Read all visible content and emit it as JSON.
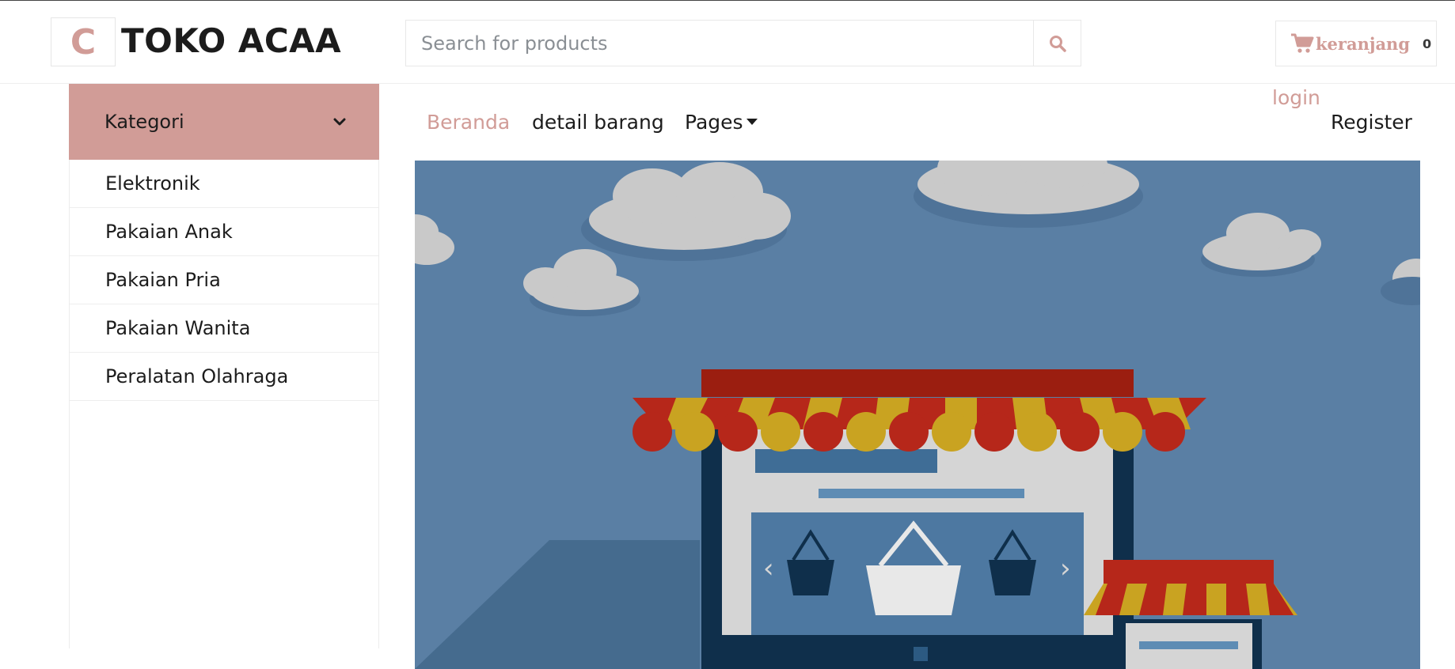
{
  "header": {
    "logo_letter": "C",
    "brand_name": "TOKO ACAA",
    "search_placeholder": "Search for products",
    "search_icon": "search-icon",
    "cart": {
      "icon": "cart-icon",
      "label": "keranjang",
      "count": "0"
    }
  },
  "sidebar": {
    "title": "Kategori",
    "toggle_icon": "chevron-down-icon",
    "items": [
      {
        "label": "Elektronik"
      },
      {
        "label": "Pakaian Anak"
      },
      {
        "label": "Pakaian Pria"
      },
      {
        "label": "Pakaian Wanita"
      },
      {
        "label": "Peralatan Olahraga"
      }
    ]
  },
  "nav": {
    "home": "Beranda",
    "detail": "detail barang",
    "pages": "Pages",
    "login": "login",
    "register": "Register"
  },
  "colors": {
    "accent": "#d19c97",
    "banner_sky": "#5a7fa4",
    "awning_red": "#b6271a",
    "awning_yellow": "#c9a321",
    "store_navy": "#0f2f4b"
  }
}
